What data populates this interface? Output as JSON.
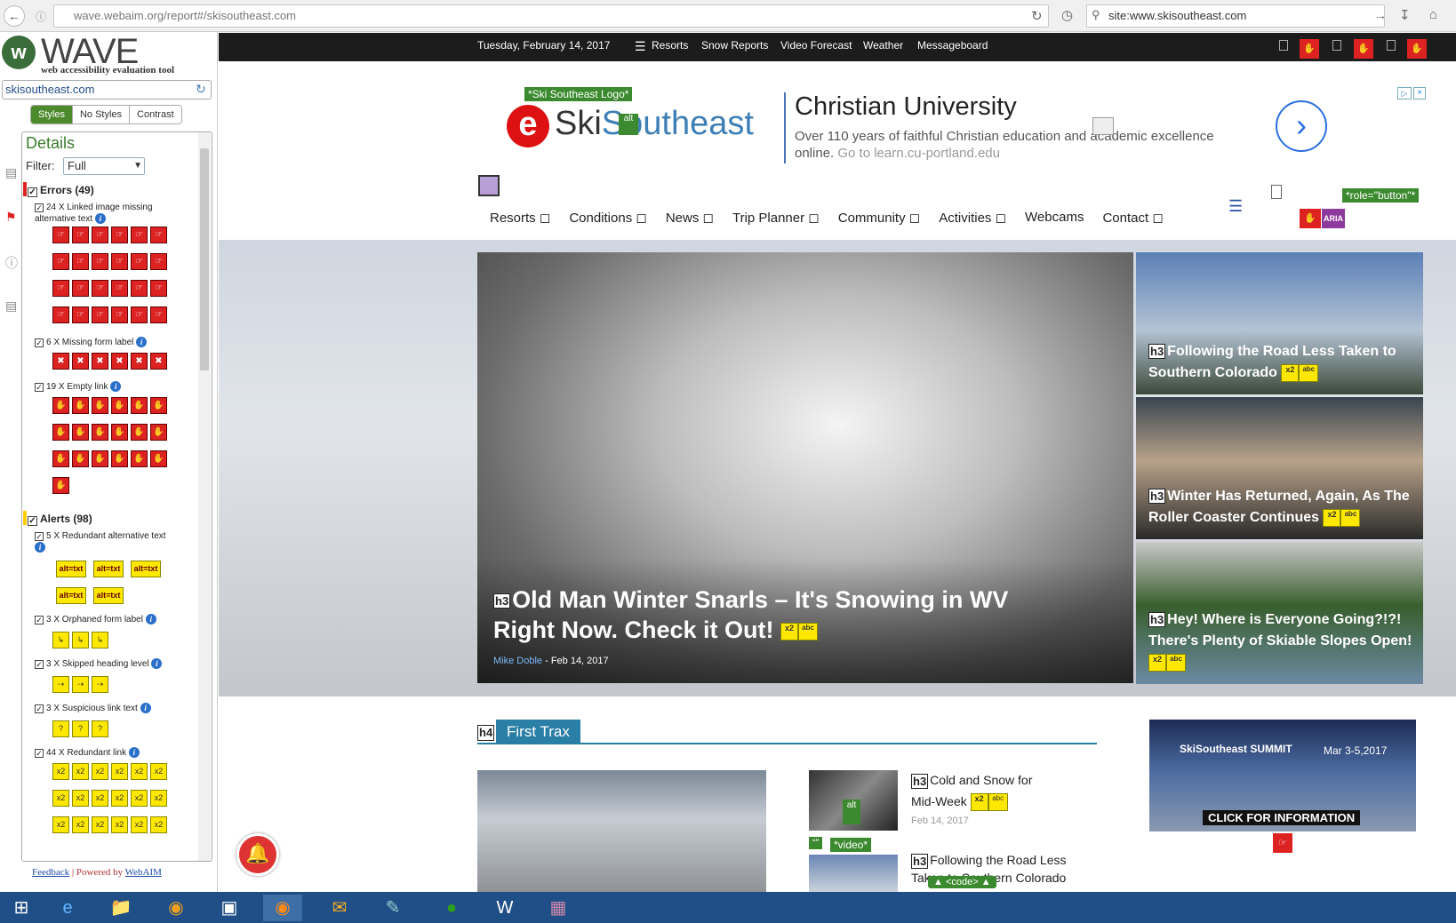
{
  "browser": {
    "url": "wave.webaim.org/report#/skisoutheast.com",
    "search": "site:www.skisoutheast.com"
  },
  "wave": {
    "title": "WAVE",
    "subtitle": "web accessibility evaluation tool",
    "site": "skisoutheast.com",
    "tabs": [
      "Styles",
      "No Styles",
      "Contrast"
    ],
    "details_title": "Details",
    "filter_label": "Filter:",
    "filter_value": "Full",
    "errors_label": "Errors (49)",
    "errors": [
      {
        "label": "24 X Linked image missing alternative text"
      },
      {
        "label": "6 X Missing form label"
      },
      {
        "label": "19 X Empty link"
      }
    ],
    "alerts_label": "Alerts (98)",
    "alerts": [
      {
        "label": "5 X Redundant alternative text"
      },
      {
        "label": "3 X Orphaned form label"
      },
      {
        "label": "3 X Skipped heading level"
      },
      {
        "label": "3 X Suspicious link text"
      },
      {
        "label": "44 X Redundant link"
      }
    ],
    "alt_icon_text": "alt=txt",
    "footer_feedback": "Feedback",
    "footer_sep": " | Powered by ",
    "footer_webaim": "WebAIM"
  },
  "site": {
    "date": "Tuesday, February 14, 2017",
    "topnav": [
      "Resorts",
      "Snow Reports",
      "Video Forecast",
      "Weather",
      "Messageboard"
    ],
    "logo_tag": "*Ski Southeast Logo*",
    "logo_ski": "Ski",
    "logo_southeast": "Southeast",
    "ad": {
      "title": "Christian University",
      "body": "Over 110 years of faithful Christian education and academic excellence online.",
      "link": "Go to learn.cu-portland.edu"
    },
    "mainnav": [
      "Resorts",
      "Conditions",
      "News",
      "Trip Planner",
      "Community",
      "Activities",
      "Webcams",
      "Contact"
    ],
    "role_button_tag": "*role=\"button\"*",
    "aria_tag": "ARIA",
    "hero": {
      "h3": "h3",
      "headline": "Old Man Winter Snarls – It's Snowing in WV Right Now. Check it Out!",
      "author": "Mike Doble",
      "date": "Feb 14, 2017"
    },
    "side_stories": [
      "Following the Road Less Taken to Southern Colorado",
      "Winter Has Returned, Again, As The Roller Coaster Continues",
      "Hey! Where is Everyone Going?!?! There's Plenty of Skiable Slopes Open!"
    ],
    "section": {
      "h4": "h4",
      "title": "First Trax"
    },
    "news": [
      {
        "title": "Cold and Snow for Mid-Week",
        "date": "Feb 14, 2017"
      },
      {
        "title": "Following the Road Less Taken to Southern Colorado",
        "date": ""
      }
    ],
    "video_tag": "*video*",
    "code_tag": "<code>",
    "promo": {
      "brand": "SkiSoutheast SUMMIT",
      "date": "Mar 3-5,2017",
      "cta": "CLICK FOR INFORMATION"
    }
  }
}
